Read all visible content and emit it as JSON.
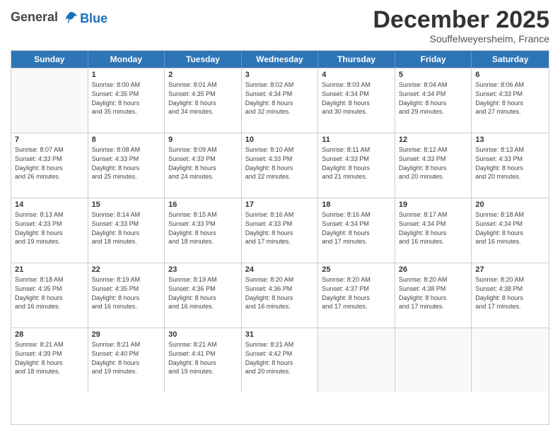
{
  "logo": {
    "general": "General",
    "blue": "Blue"
  },
  "header": {
    "month": "December 2025",
    "location": "Souffelweyersheim, France"
  },
  "days_of_week": [
    "Sunday",
    "Monday",
    "Tuesday",
    "Wednesday",
    "Thursday",
    "Friday",
    "Saturday"
  ],
  "weeks": [
    [
      {
        "num": "",
        "empty": true
      },
      {
        "num": "1",
        "sunrise": "Sunrise: 8:00 AM",
        "sunset": "Sunset: 4:35 PM",
        "daylight": "Daylight: 8 hours and 35 minutes."
      },
      {
        "num": "2",
        "sunrise": "Sunrise: 8:01 AM",
        "sunset": "Sunset: 4:35 PM",
        "daylight": "Daylight: 8 hours and 34 minutes."
      },
      {
        "num": "3",
        "sunrise": "Sunrise: 8:02 AM",
        "sunset": "Sunset: 4:34 PM",
        "daylight": "Daylight: 8 hours and 32 minutes."
      },
      {
        "num": "4",
        "sunrise": "Sunrise: 8:03 AM",
        "sunset": "Sunset: 4:34 PM",
        "daylight": "Daylight: 8 hours and 30 minutes."
      },
      {
        "num": "5",
        "sunrise": "Sunrise: 8:04 AM",
        "sunset": "Sunset: 4:34 PM",
        "daylight": "Daylight: 8 hours and 29 minutes."
      },
      {
        "num": "6",
        "sunrise": "Sunrise: 8:06 AM",
        "sunset": "Sunset: 4:33 PM",
        "daylight": "Daylight: 8 hours and 27 minutes."
      }
    ],
    [
      {
        "num": "7",
        "sunrise": "Sunrise: 8:07 AM",
        "sunset": "Sunset: 4:33 PM",
        "daylight": "Daylight: 8 hours and 26 minutes."
      },
      {
        "num": "8",
        "sunrise": "Sunrise: 8:08 AM",
        "sunset": "Sunset: 4:33 PM",
        "daylight": "Daylight: 8 hours and 25 minutes."
      },
      {
        "num": "9",
        "sunrise": "Sunrise: 8:09 AM",
        "sunset": "Sunset: 4:33 PM",
        "daylight": "Daylight: 8 hours and 24 minutes."
      },
      {
        "num": "10",
        "sunrise": "Sunrise: 8:10 AM",
        "sunset": "Sunset: 4:33 PM",
        "daylight": "Daylight: 8 hours and 22 minutes."
      },
      {
        "num": "11",
        "sunrise": "Sunrise: 8:11 AM",
        "sunset": "Sunset: 4:33 PM",
        "daylight": "Daylight: 8 hours and 21 minutes."
      },
      {
        "num": "12",
        "sunrise": "Sunrise: 8:12 AM",
        "sunset": "Sunset: 4:33 PM",
        "daylight": "Daylight: 8 hours and 20 minutes."
      },
      {
        "num": "13",
        "sunrise": "Sunrise: 8:13 AM",
        "sunset": "Sunset: 4:33 PM",
        "daylight": "Daylight: 8 hours and 20 minutes."
      }
    ],
    [
      {
        "num": "14",
        "sunrise": "Sunrise: 8:13 AM",
        "sunset": "Sunset: 4:33 PM",
        "daylight": "Daylight: 8 hours and 19 minutes."
      },
      {
        "num": "15",
        "sunrise": "Sunrise: 8:14 AM",
        "sunset": "Sunset: 4:33 PM",
        "daylight": "Daylight: 8 hours and 18 minutes."
      },
      {
        "num": "16",
        "sunrise": "Sunrise: 8:15 AM",
        "sunset": "Sunset: 4:33 PM",
        "daylight": "Daylight: 8 hours and 18 minutes."
      },
      {
        "num": "17",
        "sunrise": "Sunrise: 8:16 AM",
        "sunset": "Sunset: 4:33 PM",
        "daylight": "Daylight: 8 hours and 17 minutes."
      },
      {
        "num": "18",
        "sunrise": "Sunrise: 8:16 AM",
        "sunset": "Sunset: 4:34 PM",
        "daylight": "Daylight: 8 hours and 17 minutes."
      },
      {
        "num": "19",
        "sunrise": "Sunrise: 8:17 AM",
        "sunset": "Sunset: 4:34 PM",
        "daylight": "Daylight: 8 hours and 16 minutes."
      },
      {
        "num": "20",
        "sunrise": "Sunrise: 8:18 AM",
        "sunset": "Sunset: 4:34 PM",
        "daylight": "Daylight: 8 hours and 16 minutes."
      }
    ],
    [
      {
        "num": "21",
        "sunrise": "Sunrise: 8:18 AM",
        "sunset": "Sunset: 4:35 PM",
        "daylight": "Daylight: 8 hours and 16 minutes."
      },
      {
        "num": "22",
        "sunrise": "Sunrise: 8:19 AM",
        "sunset": "Sunset: 4:35 PM",
        "daylight": "Daylight: 8 hours and 16 minutes."
      },
      {
        "num": "23",
        "sunrise": "Sunrise: 8:19 AM",
        "sunset": "Sunset: 4:36 PM",
        "daylight": "Daylight: 8 hours and 16 minutes."
      },
      {
        "num": "24",
        "sunrise": "Sunrise: 8:20 AM",
        "sunset": "Sunset: 4:36 PM",
        "daylight": "Daylight: 8 hours and 16 minutes."
      },
      {
        "num": "25",
        "sunrise": "Sunrise: 8:20 AM",
        "sunset": "Sunset: 4:37 PM",
        "daylight": "Daylight: 8 hours and 17 minutes."
      },
      {
        "num": "26",
        "sunrise": "Sunrise: 8:20 AM",
        "sunset": "Sunset: 4:38 PM",
        "daylight": "Daylight: 8 hours and 17 minutes."
      },
      {
        "num": "27",
        "sunrise": "Sunrise: 8:20 AM",
        "sunset": "Sunset: 4:38 PM",
        "daylight": "Daylight: 8 hours and 17 minutes."
      }
    ],
    [
      {
        "num": "28",
        "sunrise": "Sunrise: 8:21 AM",
        "sunset": "Sunset: 4:39 PM",
        "daylight": "Daylight: 8 hours and 18 minutes."
      },
      {
        "num": "29",
        "sunrise": "Sunrise: 8:21 AM",
        "sunset": "Sunset: 4:40 PM",
        "daylight": "Daylight: 8 hours and 19 minutes."
      },
      {
        "num": "30",
        "sunrise": "Sunrise: 8:21 AM",
        "sunset": "Sunset: 4:41 PM",
        "daylight": "Daylight: 8 hours and 19 minutes."
      },
      {
        "num": "31",
        "sunrise": "Sunrise: 8:21 AM",
        "sunset": "Sunset: 4:42 PM",
        "daylight": "Daylight: 8 hours and 20 minutes."
      },
      {
        "num": "",
        "empty": true
      },
      {
        "num": "",
        "empty": true
      },
      {
        "num": "",
        "empty": true
      }
    ]
  ]
}
